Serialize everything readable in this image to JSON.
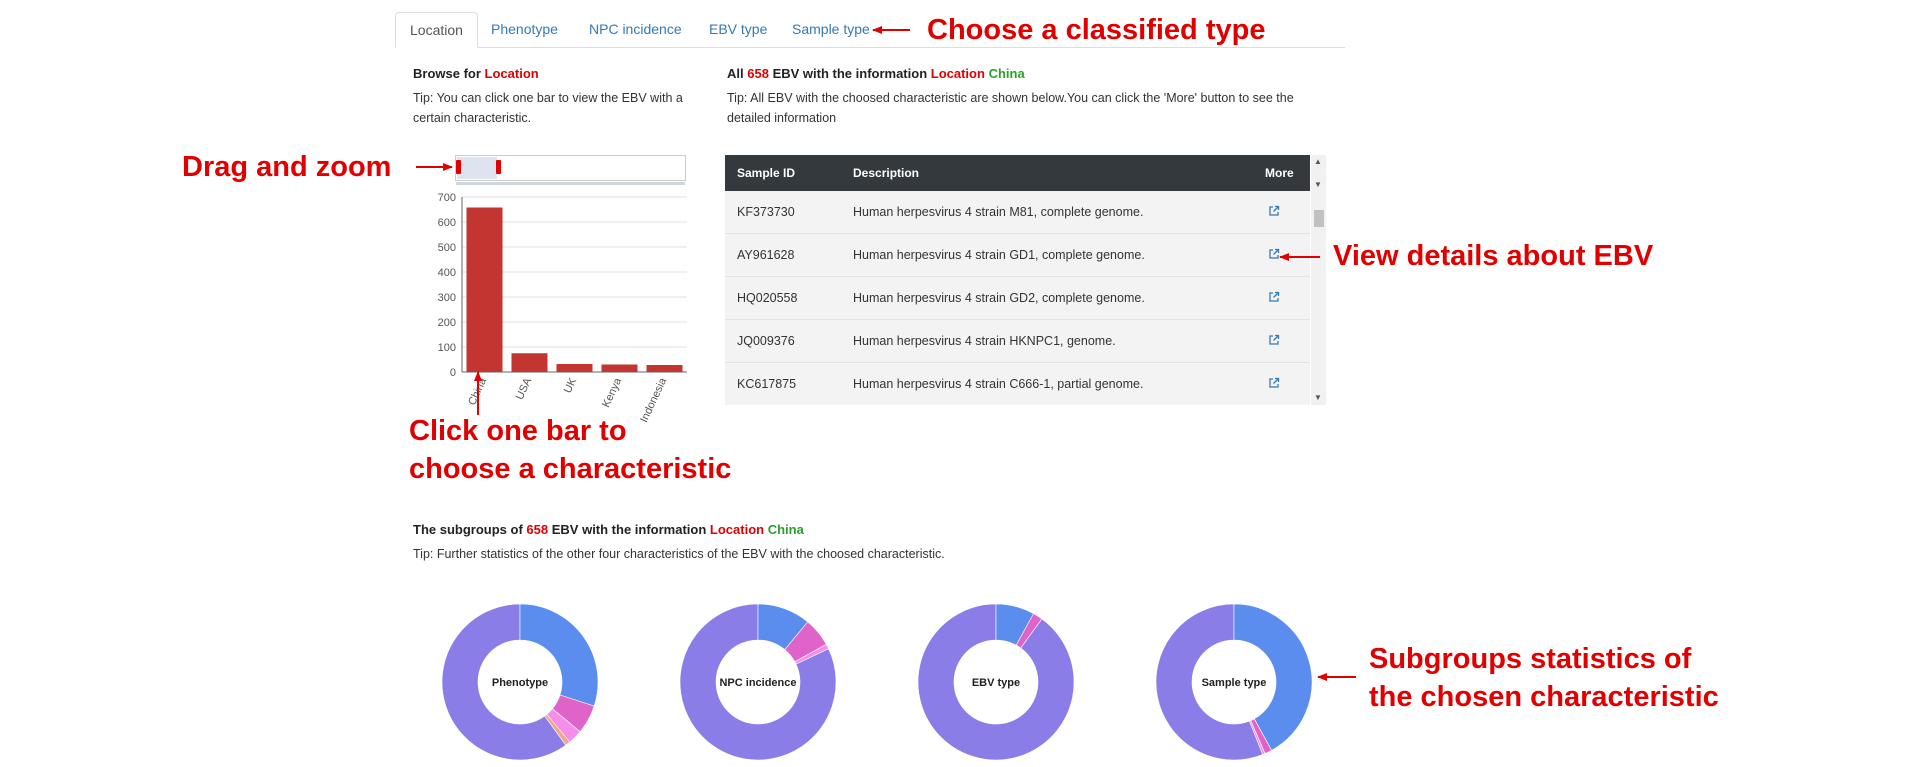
{
  "tabs": [
    {
      "label": "Location",
      "active": true
    },
    {
      "label": "Phenotype",
      "active": false
    },
    {
      "label": "NPC incidence",
      "active": false
    },
    {
      "label": "EBV type",
      "active": false
    },
    {
      "label": "Sample type",
      "active": false
    }
  ],
  "browse": {
    "prefix": "Browse for",
    "field": "Location",
    "tip": "Tip: You can click one bar to view the EBV with a certain characteristic."
  },
  "all_info": {
    "prefix": "All",
    "count": "658",
    "middle": "EBV with the information",
    "field": "Location",
    "value": "China",
    "tip": "Tip: All EBV with the choosed characteristic are shown below.You can click the 'More' button to see the detailed information"
  },
  "table": {
    "headers": [
      "Sample ID",
      "Description",
      "More"
    ],
    "rows": [
      {
        "id": "KF373730",
        "desc": "Human herpesvirus 4 strain M81, complete genome."
      },
      {
        "id": "AY961628",
        "desc": "Human herpesvirus 4 strain GD1, complete genome."
      },
      {
        "id": "HQ020558",
        "desc": "Human herpesvirus 4 strain GD2, complete genome."
      },
      {
        "id": "JQ009376",
        "desc": "Human herpesvirus 4 strain HKNPC1, genome."
      },
      {
        "id": "KC617875",
        "desc": "Human herpesvirus 4 strain C666-1, partial genome."
      }
    ]
  },
  "subgroups": {
    "prefix": "The subgroups of",
    "count": "658",
    "middle": "EBV with the information",
    "field": "Location",
    "value": "China",
    "tip": "Tip: Further statistics of the other four characteristics of the EBV with the choosed characteristic."
  },
  "chart_data": [
    {
      "type": "bar",
      "categories": [
        "China",
        "USA",
        "UK",
        "Kenya",
        "Indonesia"
      ],
      "values": [
        658,
        75,
        32,
        30,
        28
      ],
      "ylim": [
        0,
        700
      ],
      "yticks": [
        0,
        100,
        200,
        300,
        400,
        500,
        600,
        700
      ],
      "grid": true,
      "color": "#c23531"
    },
    {
      "type": "pie",
      "center_label": "Phenotype",
      "values": [
        60,
        30,
        6,
        3,
        1
      ],
      "colors": [
        "#8b7de8",
        "#5b8def",
        "#e063c9",
        "#f48ee8",
        "#f4a582"
      ]
    },
    {
      "type": "pie",
      "center_label": "NPC incidence",
      "values": [
        82,
        11,
        6,
        1
      ],
      "colors": [
        "#8b7de8",
        "#5b8def",
        "#e063c9",
        "#f48ee8"
      ]
    },
    {
      "type": "pie",
      "center_label": "EBV type",
      "values": [
        90,
        8,
        2
      ],
      "colors": [
        "#8b7de8",
        "#5b8def",
        "#e063c9"
      ]
    },
    {
      "type": "pie",
      "center_label": "Sample type",
      "values": [
        56,
        42,
        1.5,
        0.5
      ],
      "colors": [
        "#8b7de8",
        "#5b8def",
        "#e063c9",
        "#f48ee8"
      ]
    }
  ],
  "annotations": {
    "tabs": "Choose a classified type",
    "zoom": "Drag and zoom",
    "click_line1": "Click one bar to",
    "click_line2": "choose a characteristic",
    "details": "View details about EBV",
    "subgroups_line1": "Subgroups statistics of",
    "subgroups_line2": "the chosen characteristic"
  },
  "colors": {
    "annotation": "#e00000",
    "value_green": "#2ca02c",
    "link": "#337ab7",
    "table_header": "#34393e"
  }
}
